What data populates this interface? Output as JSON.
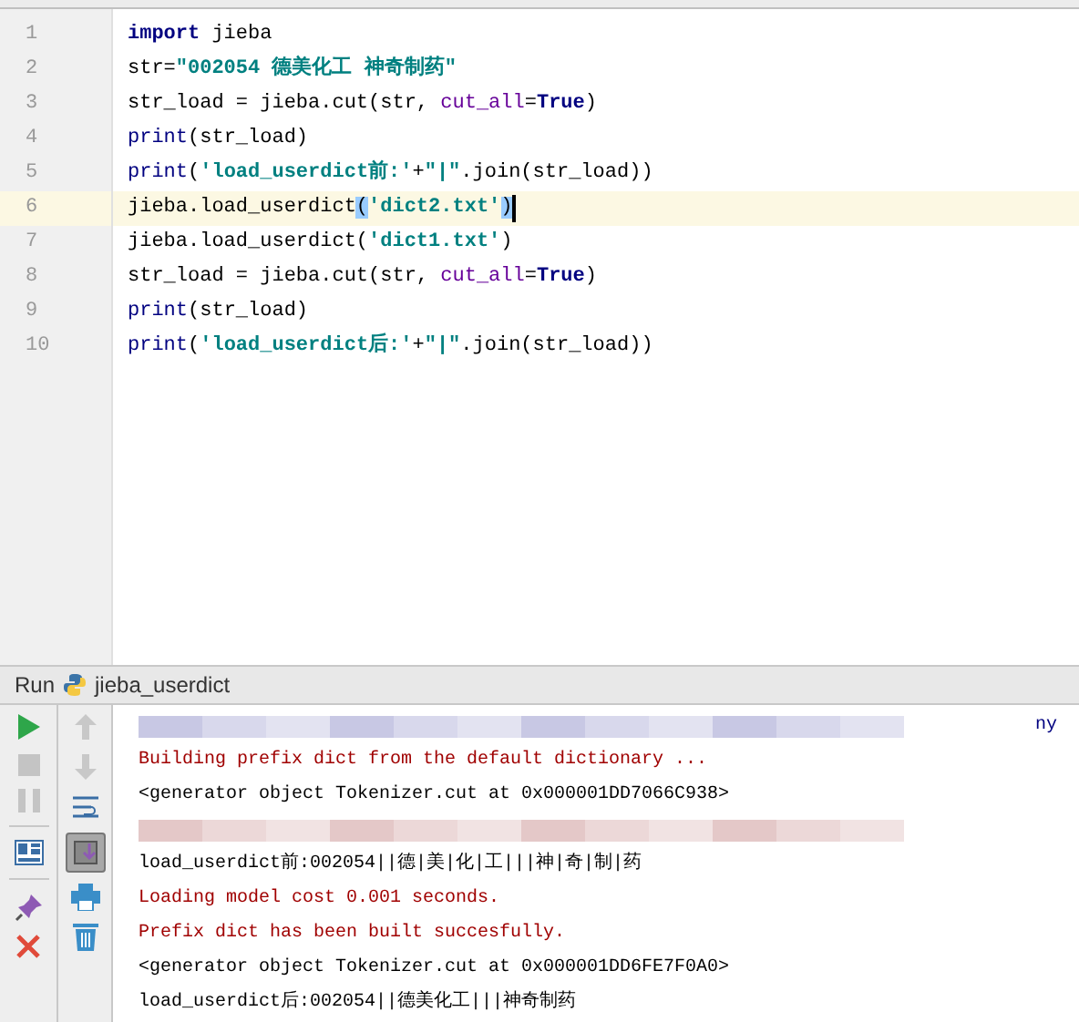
{
  "editor": {
    "lines": [
      {
        "number": "1",
        "current": false,
        "segments": [
          {
            "kind": "keyword",
            "text": "import"
          },
          {
            "kind": "plain",
            "text": " jieba"
          }
        ]
      },
      {
        "number": "2",
        "current": false,
        "segments": [
          {
            "kind": "plain",
            "text": "str="
          },
          {
            "kind": "string",
            "text": "\"002054 德美化工 神奇制药\""
          }
        ]
      },
      {
        "number": "3",
        "current": false,
        "segments": [
          {
            "kind": "plain",
            "text": "str_load = jieba.cut(str, "
          },
          {
            "kind": "param",
            "text": "cut_all"
          },
          {
            "kind": "plain",
            "text": "="
          },
          {
            "kind": "keyword",
            "text": "True"
          },
          {
            "kind": "plain",
            "text": ")"
          }
        ]
      },
      {
        "number": "4",
        "current": false,
        "segments": [
          {
            "kind": "builtin",
            "text": "print"
          },
          {
            "kind": "plain",
            "text": "(str_load)"
          }
        ]
      },
      {
        "number": "5",
        "current": false,
        "segments": [
          {
            "kind": "builtin",
            "text": "print"
          },
          {
            "kind": "plain",
            "text": "("
          },
          {
            "kind": "string",
            "text": "'load_userdict前:'"
          },
          {
            "kind": "plain",
            "text": "+"
          },
          {
            "kind": "string",
            "text": "\"|\""
          },
          {
            "kind": "plain",
            "text": ".join(str_load))"
          }
        ]
      },
      {
        "number": "6",
        "current": true,
        "segments": [
          {
            "kind": "plain",
            "text": "jieba.load_userdict"
          },
          {
            "kind": "match",
            "text": "("
          },
          {
            "kind": "string",
            "text": "'dict2.txt'"
          },
          {
            "kind": "match",
            "text": ")"
          }
        ]
      },
      {
        "number": "7",
        "current": false,
        "segments": [
          {
            "kind": "plain",
            "text": "jieba.load_userdict("
          },
          {
            "kind": "string",
            "text": "'dict1.txt'"
          },
          {
            "kind": "plain",
            "text": ")"
          }
        ]
      },
      {
        "number": "8",
        "current": false,
        "segments": [
          {
            "kind": "plain",
            "text": "str_load = jieba.cut(str, "
          },
          {
            "kind": "param",
            "text": "cut_all"
          },
          {
            "kind": "plain",
            "text": "="
          },
          {
            "kind": "keyword",
            "text": "True"
          },
          {
            "kind": "plain",
            "text": ")"
          }
        ]
      },
      {
        "number": "9",
        "current": false,
        "segments": [
          {
            "kind": "builtin",
            "text": "print"
          },
          {
            "kind": "plain",
            "text": "(str_load)"
          }
        ]
      },
      {
        "number": "10",
        "current": false,
        "segments": [
          {
            "kind": "builtin",
            "text": "print"
          },
          {
            "kind": "plain",
            "text": "("
          },
          {
            "kind": "string",
            "text": "'load_userdict后:'"
          },
          {
            "kind": "plain",
            "text": "+"
          },
          {
            "kind": "string",
            "text": "\"|\""
          },
          {
            "kind": "plain",
            "text": ".join(str_load))"
          }
        ]
      }
    ]
  },
  "run_panel": {
    "label": "Run",
    "config": "jieba_userdict",
    "console": [
      {
        "kind": "redacted",
        "color": "#c8c8e4",
        "tail": "ny"
      },
      {
        "kind": "error",
        "text": "Building prefix dict from the default dictionary ..."
      },
      {
        "kind": "output",
        "text": "<generator object Tokenizer.cut at 0x000001DD7066C938>"
      },
      {
        "kind": "redacted",
        "color": "#e4c8c8"
      },
      {
        "kind": "output",
        "text": "load_userdict前:002054||德|美|化|工|||神|奇|制|药"
      },
      {
        "kind": "error",
        "text": "Loading model cost 0.001 seconds."
      },
      {
        "kind": "error",
        "text": "Prefix dict has been built succesfully."
      },
      {
        "kind": "output",
        "text": "<generator object Tokenizer.cut at 0x000001DD6FE7F0A0>"
      },
      {
        "kind": "output",
        "text": "load_userdict后:002054||德美化工|||神奇制药"
      }
    ]
  }
}
